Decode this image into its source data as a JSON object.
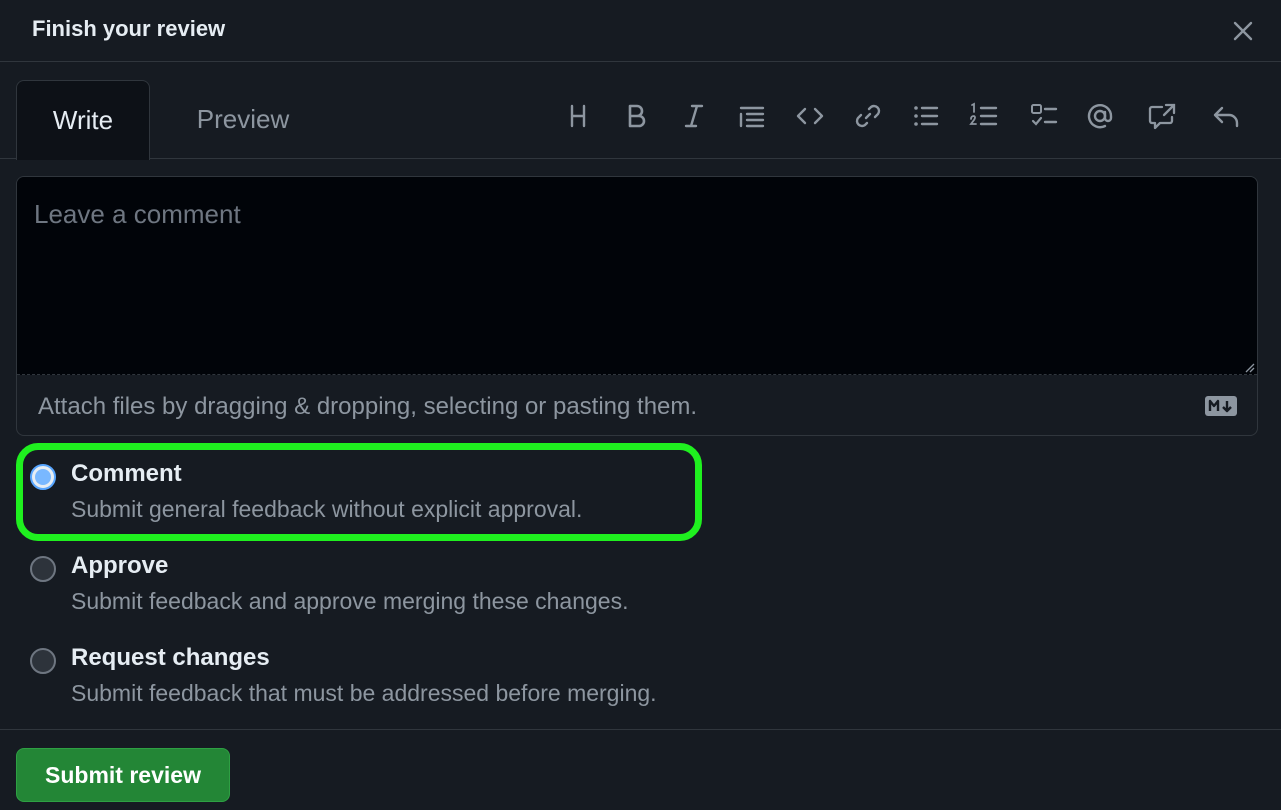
{
  "dialog": {
    "title": "Finish your review",
    "close_icon": "x-icon"
  },
  "tabs": [
    {
      "label": "Write",
      "active": true
    },
    {
      "label": "Preview",
      "active": false
    }
  ],
  "toolbar": [
    {
      "name": "heading",
      "icon": "heading-icon"
    },
    {
      "name": "bold",
      "icon": "bold-icon"
    },
    {
      "name": "italic",
      "icon": "italic-icon"
    },
    {
      "name": "quote",
      "icon": "quote-icon"
    },
    {
      "name": "code",
      "icon": "code-icon"
    },
    {
      "name": "link",
      "icon": "link-icon"
    },
    {
      "name": "unordered-list",
      "icon": "list-unordered-icon"
    },
    {
      "name": "ordered-list",
      "icon": "list-ordered-icon"
    },
    {
      "name": "task-list",
      "icon": "tasklist-icon"
    },
    {
      "name": "mention",
      "icon": "mention-icon"
    },
    {
      "name": "reference",
      "icon": "cross-reference-icon"
    },
    {
      "name": "saved-reply",
      "icon": "reply-icon"
    }
  ],
  "editor": {
    "placeholder": "Leave a comment",
    "value": "",
    "attach_text": "Attach files by dragging & dropping, selecting or pasting them.",
    "markdown_icon": "markdown-icon"
  },
  "review_options": [
    {
      "label": "Comment",
      "description": "Submit general feedback without explicit approval.",
      "checked": true
    },
    {
      "label": "Approve",
      "description": "Submit feedback and approve merging these changes.",
      "checked": false
    },
    {
      "label": "Request changes",
      "description": "Submit feedback that must be addressed before merging.",
      "checked": false
    }
  ],
  "colors": {
    "background": "#161b22",
    "editor_background": "#010409",
    "border": "#30363d",
    "primary_button": "#238636",
    "highlight": "#1ff01f",
    "radio_checked": "#58a6ff"
  },
  "footer": {
    "submit_label": "Submit review"
  }
}
